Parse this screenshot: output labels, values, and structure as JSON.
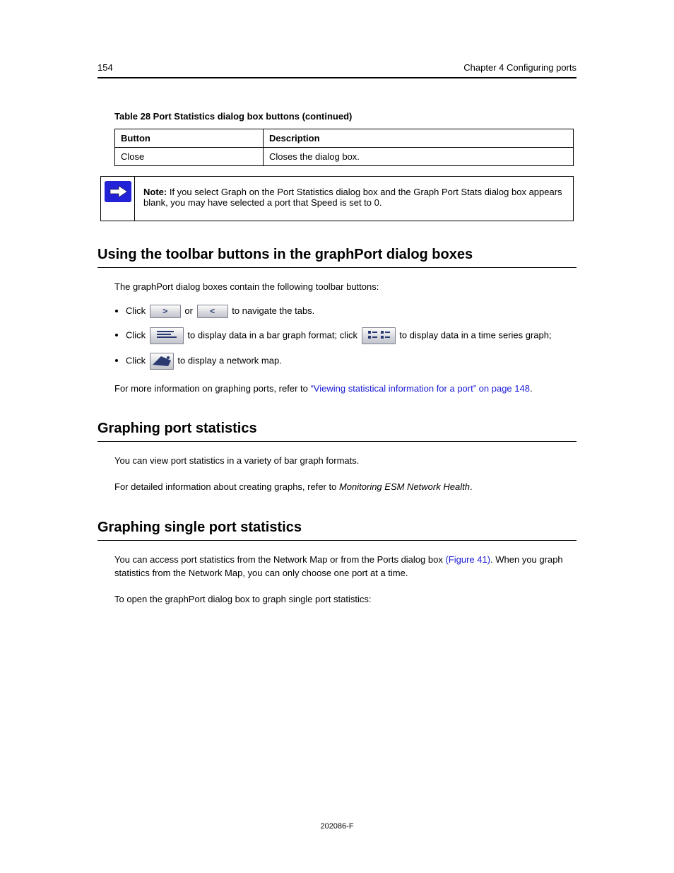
{
  "header": {
    "page_number": "154",
    "chapter": "Chapter 4 Configuring ports"
  },
  "table_caption": "Table 28   Port Statistics dialog box buttons (continued)",
  "table": {
    "headers": [
      "Button",
      "Description"
    ],
    "row": [
      "Close",
      "Closes the dialog box."
    ]
  },
  "note": {
    "label": "Note:",
    "text": "If you select Graph on the Port Statistics dialog box and the Graph Port Stats dialog box appears blank, you may have selected a port that Speed is set to 0."
  },
  "section_toolbar": {
    "heading": "Using the toolbar buttons in the graphPort dialog boxes",
    "intro": "The graphPort dialog boxes contain the following toolbar buttons:",
    "items": {
      "navigate": {
        "pre": "Click ",
        "mid": " or ",
        "post": " to navigate the tabs."
      },
      "stacked": {
        "pre": "Click ",
        "mid1": " to display data in a bar graph format; click ",
        "mid2": " to display data in a time series graph;"
      },
      "network": {
        "pre": "Click ",
        "post": " to display a network map."
      }
    },
    "outro_prefix": "For more information on graphing ports, refer to ",
    "outro_link": "“Viewing statistical information for a port” on page 148",
    "outro_suffix": "."
  },
  "section_graph": {
    "heading": "Graphing port statistics",
    "p1": "You can view port statistics in a variety of bar graph formats.",
    "p2": "For detailed information about creating graphs, refer to Monitoring ESM Network Health."
  },
  "section_single": {
    "heading": "Graphing single port statistics",
    "p1_prefix": "You can access port statistics from the Network Map or from the Ports dialog box ",
    "p1_link": "(Figure 41)",
    "p1_suffix": ". When you graph statistics from the Network Map, you can only choose one port at a time.",
    "p2": "To open the graphPort dialog box to graph single port statistics:"
  },
  "footer": "202086-F"
}
